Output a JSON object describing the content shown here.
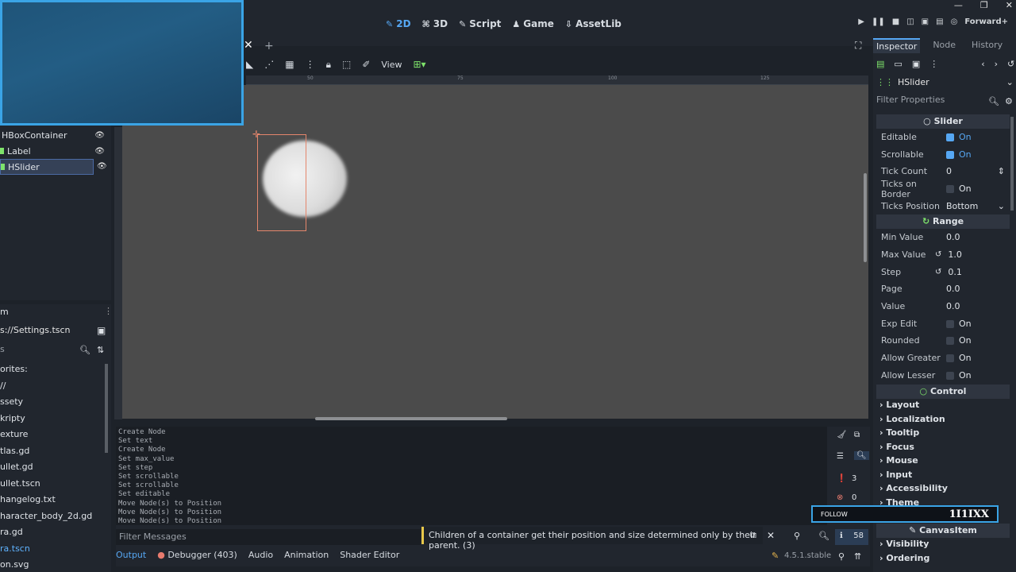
{
  "main_tabs": [
    {
      "icon": "✎",
      "label": "2D"
    },
    {
      "icon": "⌘",
      "label": "3D"
    },
    {
      "icon": "✎",
      "label": "Script"
    },
    {
      "icon": "♟",
      "label": "Game"
    },
    {
      "icon": "⇩",
      "label": "AssetLib"
    }
  ],
  "renderer": "Forward+",
  "toolbar2": {
    "view_label": "View"
  },
  "ruler_ticks": [
    "50",
    "75",
    "100",
    "125"
  ],
  "scene_tree": [
    {
      "label": "HBoxContainer"
    },
    {
      "label": "Label"
    },
    {
      "label": "HSlider"
    }
  ],
  "filesystem": {
    "header": "m",
    "path": "s://Settings.tscn",
    "search_placeholder": "s",
    "items": [
      "orites:",
      "//",
      "ssety",
      "kripty",
      "exture",
      "tlas.gd",
      "ullet.gd",
      "ullet.tscn",
      "hangelog.txt",
      "haracter_body_2d.gd",
      "ra.gd",
      "ra.tscn",
      "on.svg"
    ]
  },
  "log_lines": [
    "Create Node",
    "Set text",
    "Create Node",
    "Set max_value",
    "Set step",
    "Set scrollable",
    "Set scrollable",
    "Set editable",
    "Move Node(s) to Position",
    "Move Node(s) to Position",
    "Move Node(s) to Position"
  ],
  "log_counts": {
    "warnings": "3",
    "errors": "0"
  },
  "filter_messages_placeholder": "Filter Messages",
  "warning_tooltip": "Children of a container get their position and size determined only by their parent.  (3)",
  "output_count": "58",
  "bottom_tabs": {
    "output": "Output",
    "debugger": "Debugger (403)",
    "audio": "Audio",
    "animation": "Animation",
    "shader_editor": "Shader Editor"
  },
  "version": "4.5.1.stable",
  "inspector": {
    "tabs": {
      "inspector": "Inspector",
      "node": "Node",
      "history": "History"
    },
    "node_name": "HSlider",
    "filter_placeholder": "Filter Properties",
    "sections": {
      "slider": "Slider",
      "range": "Range",
      "control": "Control",
      "canvas_item": "CanvasItem"
    },
    "slider_props": [
      {
        "name": "Editable",
        "value": "On",
        "checked": true
      },
      {
        "name": "Scrollable",
        "value": "On",
        "checked": true
      },
      {
        "name": "Tick Count",
        "value": "0"
      },
      {
        "name": "Ticks on Border",
        "value": "On",
        "checked": false
      },
      {
        "name": "Ticks Position",
        "value": "Bottom"
      }
    ],
    "range_props": [
      {
        "name": "Min Value",
        "value": "0.0"
      },
      {
        "name": "Max Value",
        "value": "1.0"
      },
      {
        "name": "Step",
        "value": "0.1"
      },
      {
        "name": "Page",
        "value": "0.0"
      },
      {
        "name": "Value",
        "value": "0.0"
      },
      {
        "name": "Exp Edit",
        "value": "On",
        "checked": false
      },
      {
        "name": "Rounded",
        "value": "On",
        "checked": false
      },
      {
        "name": "Allow Greater",
        "value": "On",
        "checked": false
      },
      {
        "name": "Allow Lesser",
        "value": "On",
        "checked": false
      }
    ],
    "control_groups": [
      "Layout",
      "Localization",
      "Tooltip",
      "Focus",
      "Mouse",
      "Input",
      "Accessibility",
      "Theme"
    ],
    "canvas_groups": [
      "Visibility",
      "Ordering"
    ]
  },
  "overlay": {
    "follow": "FOLLOW",
    "handle": "1I1IXX"
  },
  "colors": {
    "accent": "#56a7f3",
    "selection": "#e5866c",
    "warning": "#e8c84a",
    "error": "#e87b6e",
    "viewport_bg": "#4b4b4b"
  }
}
